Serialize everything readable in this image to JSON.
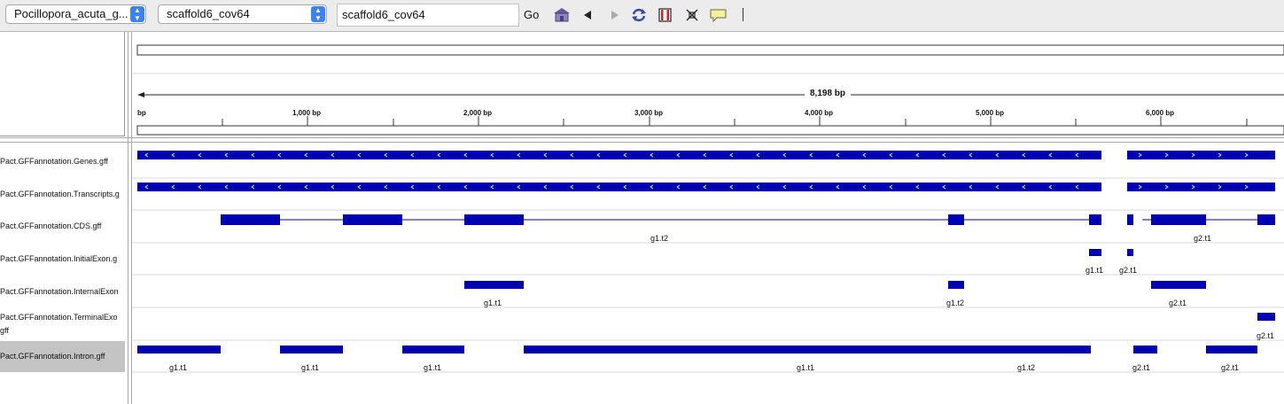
{
  "toolbar": {
    "genome": "Pocillopora_acuta_g...",
    "chromosome": "scaffold6_cov64",
    "locus": "scaffold6_cov64",
    "go_label": "Go"
  },
  "ruler": {
    "span_label": "8,198 bp",
    "start_fragment": "bp",
    "ticks": [
      "1,000 bp",
      "2,000 bp",
      "3,000 bp",
      "4,000 bp",
      "5,000 bp",
      "6,000 bp"
    ]
  },
  "tracks": [
    {
      "name": "Pact.GFFannotation.Genes.gff"
    },
    {
      "name": "Pact.GFFannotation.Transcripts.g"
    },
    {
      "name": "Pact.GFFannotation.CDS.gff",
      "labels": [
        "g1.t2",
        "g2.t1"
      ]
    },
    {
      "name": "Pact.GFFannotation.InitialExon.g",
      "labels": [
        "g1.t1",
        "g2.t1"
      ]
    },
    {
      "name": "Pact.GFFannotation.InternalExon",
      "labels": [
        "g1.t1",
        "g1.t2",
        "g2.t1"
      ]
    },
    {
      "name": "Pact.GFFannotation.TerminalExo",
      "name2": "gff",
      "labels": [
        "g2.t1"
      ]
    },
    {
      "name": "Pact.GFFannotation.Intron.gff",
      "labels": [
        "g1.t1",
        "g1.t1",
        "g1.t1",
        "g1.t1",
        "g1.t2",
        "g2.t1",
        "g2.t1"
      ]
    }
  ],
  "colors": {
    "feature": "#0000b2",
    "feature_highlight": "#3030e0",
    "selected_track": "#c4c4c4"
  },
  "icons": [
    "home-icon",
    "back-icon",
    "forward-icon",
    "refresh-icon",
    "region-icon",
    "resize-icon",
    "popup-icon"
  ]
}
